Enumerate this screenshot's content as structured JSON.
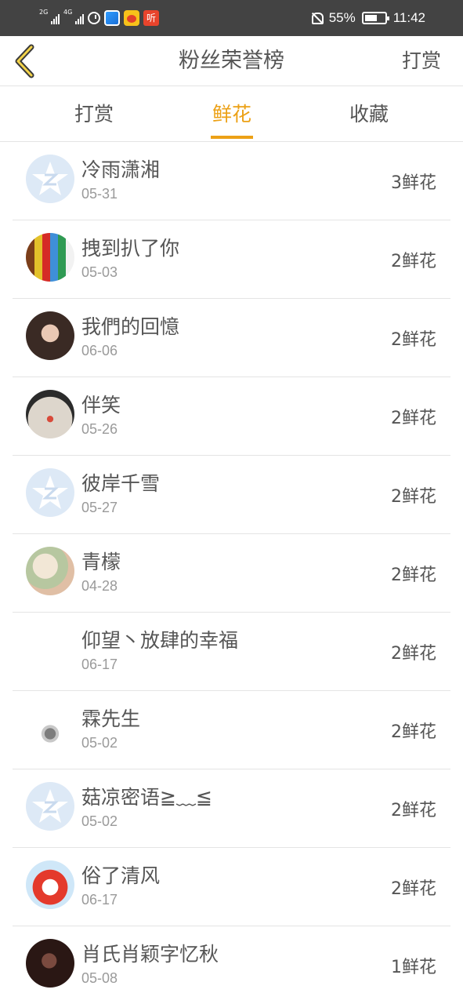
{
  "status_bar": {
    "signal1_tag": "2G",
    "signal2_tag": "4G",
    "listen_badge": "听",
    "battery": "55%",
    "time": "11:42",
    "battery_level": 0.55
  },
  "nav": {
    "title": "粉丝荣誉榜",
    "action": "打赏"
  },
  "tabs": [
    {
      "label": "打赏",
      "active": false
    },
    {
      "label": "鲜花",
      "active": true
    },
    {
      "label": "收藏",
      "active": false
    }
  ],
  "accent_color": "#eca116",
  "fans": [
    {
      "name": "冷雨潇湘",
      "date": "05-31",
      "count": "3鲜花",
      "avatar": "qq-default-avatar"
    },
    {
      "name": "拽到扒了你",
      "date": "05-03",
      "count": "2鲜花",
      "avatar": "colored-pencils-avatar"
    },
    {
      "name": "我們的回憶",
      "date": "06-06",
      "count": "2鲜花",
      "avatar": "girl-portrait-avatar"
    },
    {
      "name": "伴笑",
      "date": "05-26",
      "count": "2鲜花",
      "avatar": "clown-face-avatar"
    },
    {
      "name": "彼岸千雪",
      "date": "05-27",
      "count": "2鲜花",
      "avatar": "qq-default-avatar"
    },
    {
      "name": "青檬",
      "date": "04-28",
      "count": "2鲜花",
      "avatar": "flower-painting-avatar"
    },
    {
      "name": "仰望丶放肆的幸福",
      "date": "06-17",
      "count": "2鲜花",
      "avatar": "blank-avatar"
    },
    {
      "name": "霖先生",
      "date": "05-02",
      "count": "2鲜花",
      "avatar": "ink-sketch-avatar"
    },
    {
      "name": "菇凉密语≧﹏≦",
      "date": "05-02",
      "count": "2鲜花",
      "avatar": "qq-default-avatar"
    },
    {
      "name": "俗了清风",
      "date": "06-17",
      "count": "2鲜花",
      "avatar": "cartoon-fox-avatar"
    },
    {
      "name": "肖氏肖颖字忆秋",
      "date": "05-08",
      "count": "1鲜花",
      "avatar": "dark-portrait-avatar"
    }
  ]
}
